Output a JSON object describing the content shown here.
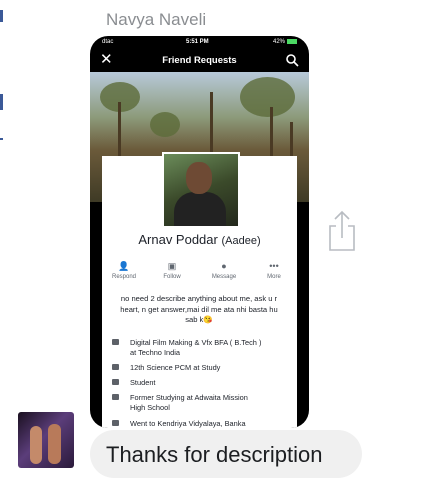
{
  "conversation": {
    "sender_name": "Navya Naveli",
    "reply_message": "Thanks for description"
  },
  "screenshot": {
    "status_bar": {
      "carrier": "dtac",
      "time": "5:51 PM",
      "battery": "42%"
    },
    "nav": {
      "title": "Friend Requests",
      "close_icon": "close-icon",
      "search_icon": "search-icon"
    },
    "profile": {
      "name": "Arnav Poddar",
      "nickname": "(Aadee)",
      "actions": [
        {
          "label": "Respond",
          "icon": "person-check-icon"
        },
        {
          "label": "Follow",
          "icon": "follow-icon"
        },
        {
          "label": "Message",
          "icon": "messenger-icon"
        },
        {
          "label": "More",
          "icon": "more-icon"
        }
      ],
      "bio_line1": "no need 2 describe anything about me, ask u r",
      "bio_line2": "heart, n get answer,mai dil me ata nhi basta hu",
      "bio_line3": "sab k😘",
      "info": [
        {
          "line1": "Digital Film Making & Vfx BFA ( B.Tech )",
          "line2": "at Techno India"
        },
        {
          "line1": "12th Science PCM at Study",
          "line2": ""
        },
        {
          "line1": "Student",
          "line2": ""
        },
        {
          "line1": "Former Studying at Adwaita Mission",
          "line2": "High School"
        },
        {
          "line1": "Went to Kendriya Vidyalaya, Banka",
          "line2": ""
        }
      ]
    }
  },
  "colors": {
    "accent": "#3b5998",
    "bubble": "#f0f0f0",
    "sender": "#8a8d91"
  }
}
